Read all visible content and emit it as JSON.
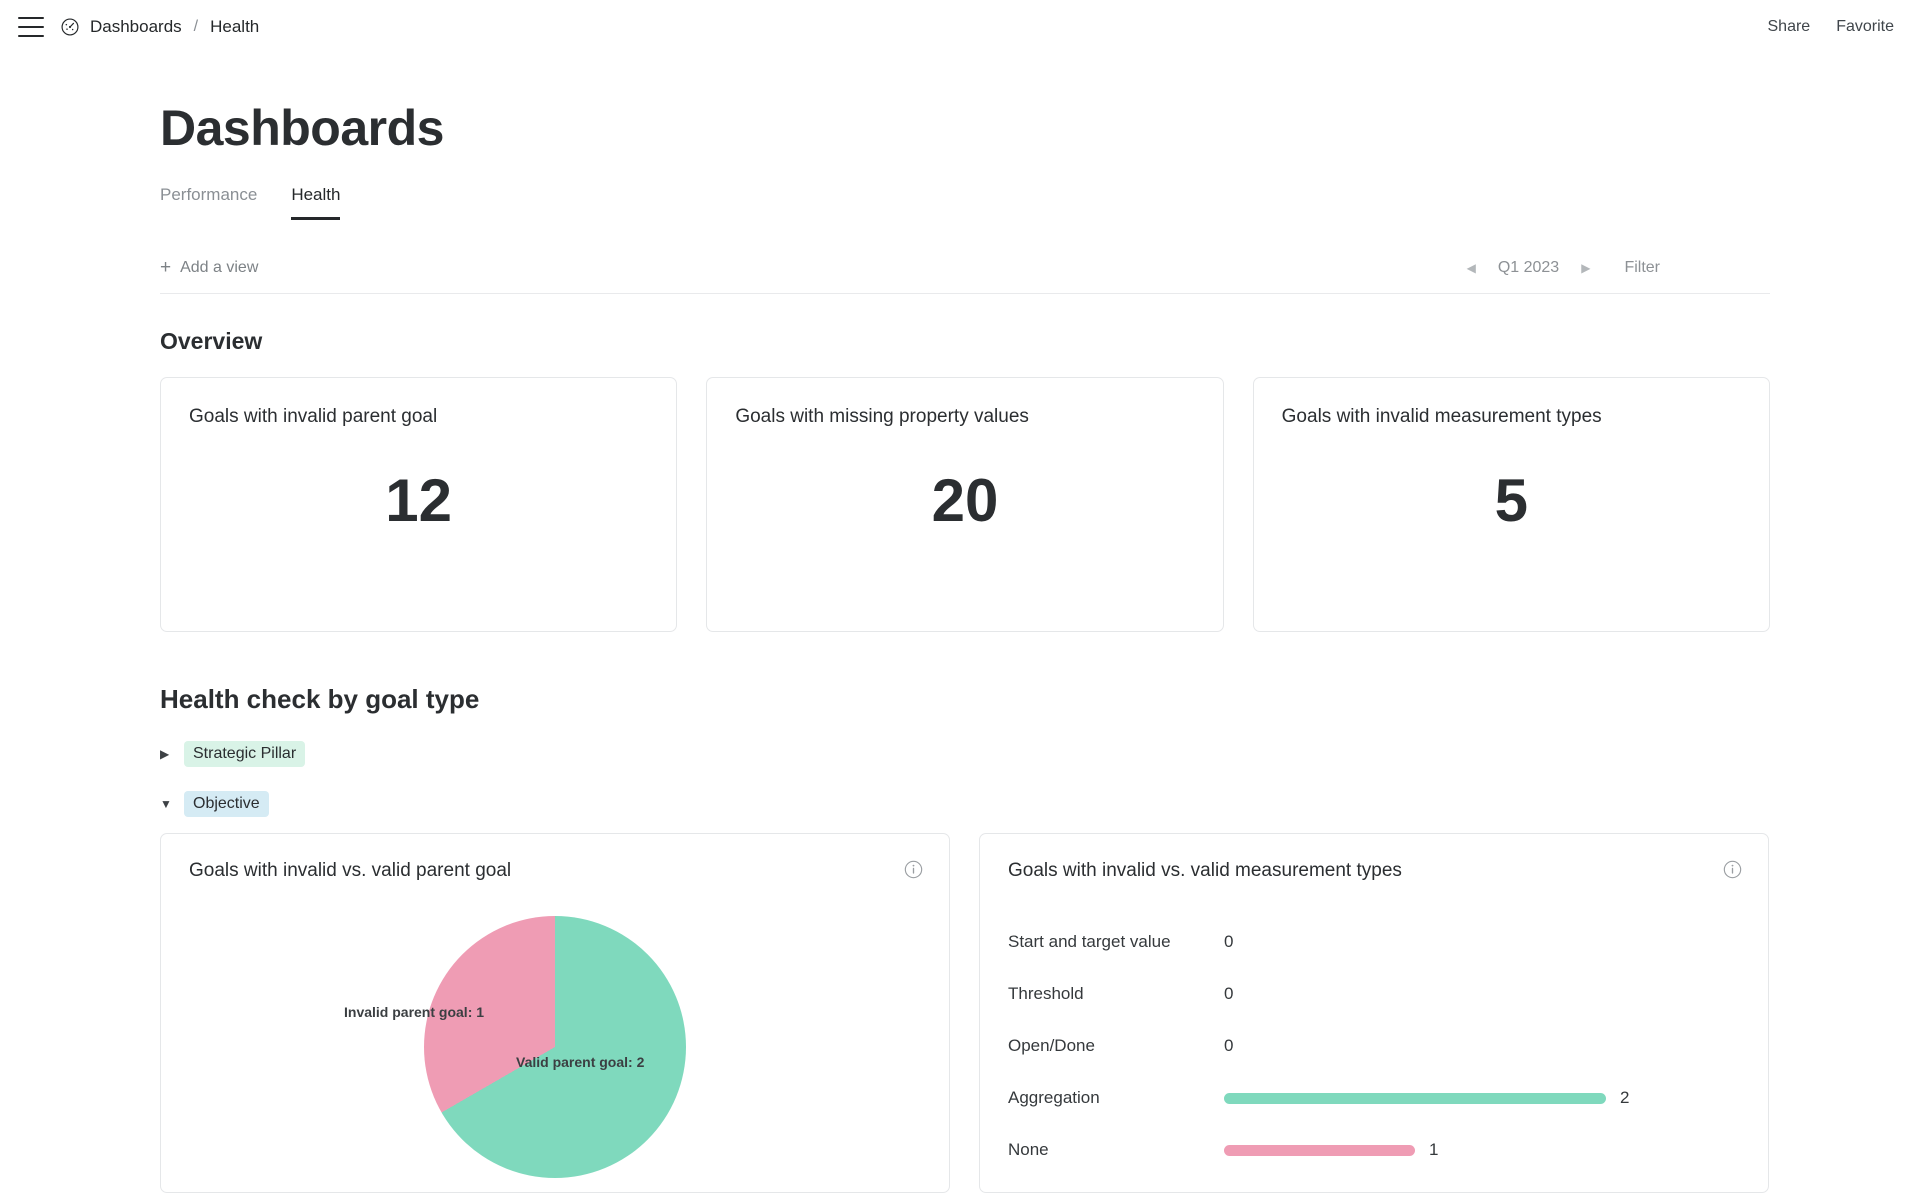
{
  "topbar": {
    "menu_icon": "hamburger-menu-icon",
    "app_icon": "gauge-icon",
    "breadcrumb_root": "Dashboards",
    "breadcrumb_separator": "/",
    "breadcrumb_current": "Health",
    "share_label": "Share",
    "favorite_label": "Favorite"
  },
  "page": {
    "title": "Dashboards",
    "tabs": [
      {
        "label": "Performance",
        "active": false
      },
      {
        "label": "Health",
        "active": true
      }
    ],
    "view_bar": {
      "add_view_label": "Add a view",
      "plus_icon": "plus-icon",
      "prev_icon": "◀",
      "period": "Q1 2023",
      "next_icon": "▶",
      "filter_label": "Filter"
    },
    "overview": {
      "heading": "Overview",
      "cards": [
        {
          "title": "Goals with invalid parent goal",
          "value": "12"
        },
        {
          "title": "Goals with missing property values",
          "value": "20"
        },
        {
          "title": "Goals with invalid measurement types",
          "value": "5"
        }
      ]
    },
    "health_check": {
      "heading": "Health check by goal type",
      "groups": [
        {
          "name": "Strategic Pillar",
          "expanded": false,
          "disclosure": "▶",
          "badge_color": "#d9f3e7"
        },
        {
          "name": "Objective",
          "expanded": true,
          "disclosure": "▼",
          "badge_color": "#d5ebf4"
        }
      ]
    }
  },
  "colors": {
    "green": "#7fd9bd",
    "pink": "#ef9cb4",
    "text": "#2b2e31",
    "muted": "#8a8f94",
    "border": "#e5e7e9"
  },
  "chart_data": [
    {
      "type": "pie",
      "title": "Goals with invalid vs. valid parent goal",
      "info_icon": "info-icon",
      "labels": [
        "Invalid parent goal",
        "Valid parent goal"
      ],
      "values": [
        1,
        2
      ],
      "colors": [
        "#ef9cb4",
        "#7fd9bd"
      ],
      "data_labels": [
        "Invalid parent goal: 1",
        "Valid parent goal: 2"
      ],
      "legend": "none",
      "total": 3
    },
    {
      "type": "bar",
      "title": "Goals with invalid vs. valid measurement types",
      "info_icon": "info-icon",
      "orientation": "horizontal",
      "categories": [
        "Start and target value",
        "Threshold",
        "Open/Done",
        "Aggregation",
        "None"
      ],
      "values": [
        0,
        0,
        0,
        2,
        1
      ],
      "value_labels": [
        "0",
        "0",
        "0",
        "2",
        "1"
      ],
      "bar_colors": [
        "#7fd9bd",
        "#7fd9bd",
        "#7fd9bd",
        "#7fd9bd",
        "#ef9cb4"
      ],
      "xlim": [
        0,
        2
      ],
      "grid": false,
      "legend": "none"
    }
  ]
}
